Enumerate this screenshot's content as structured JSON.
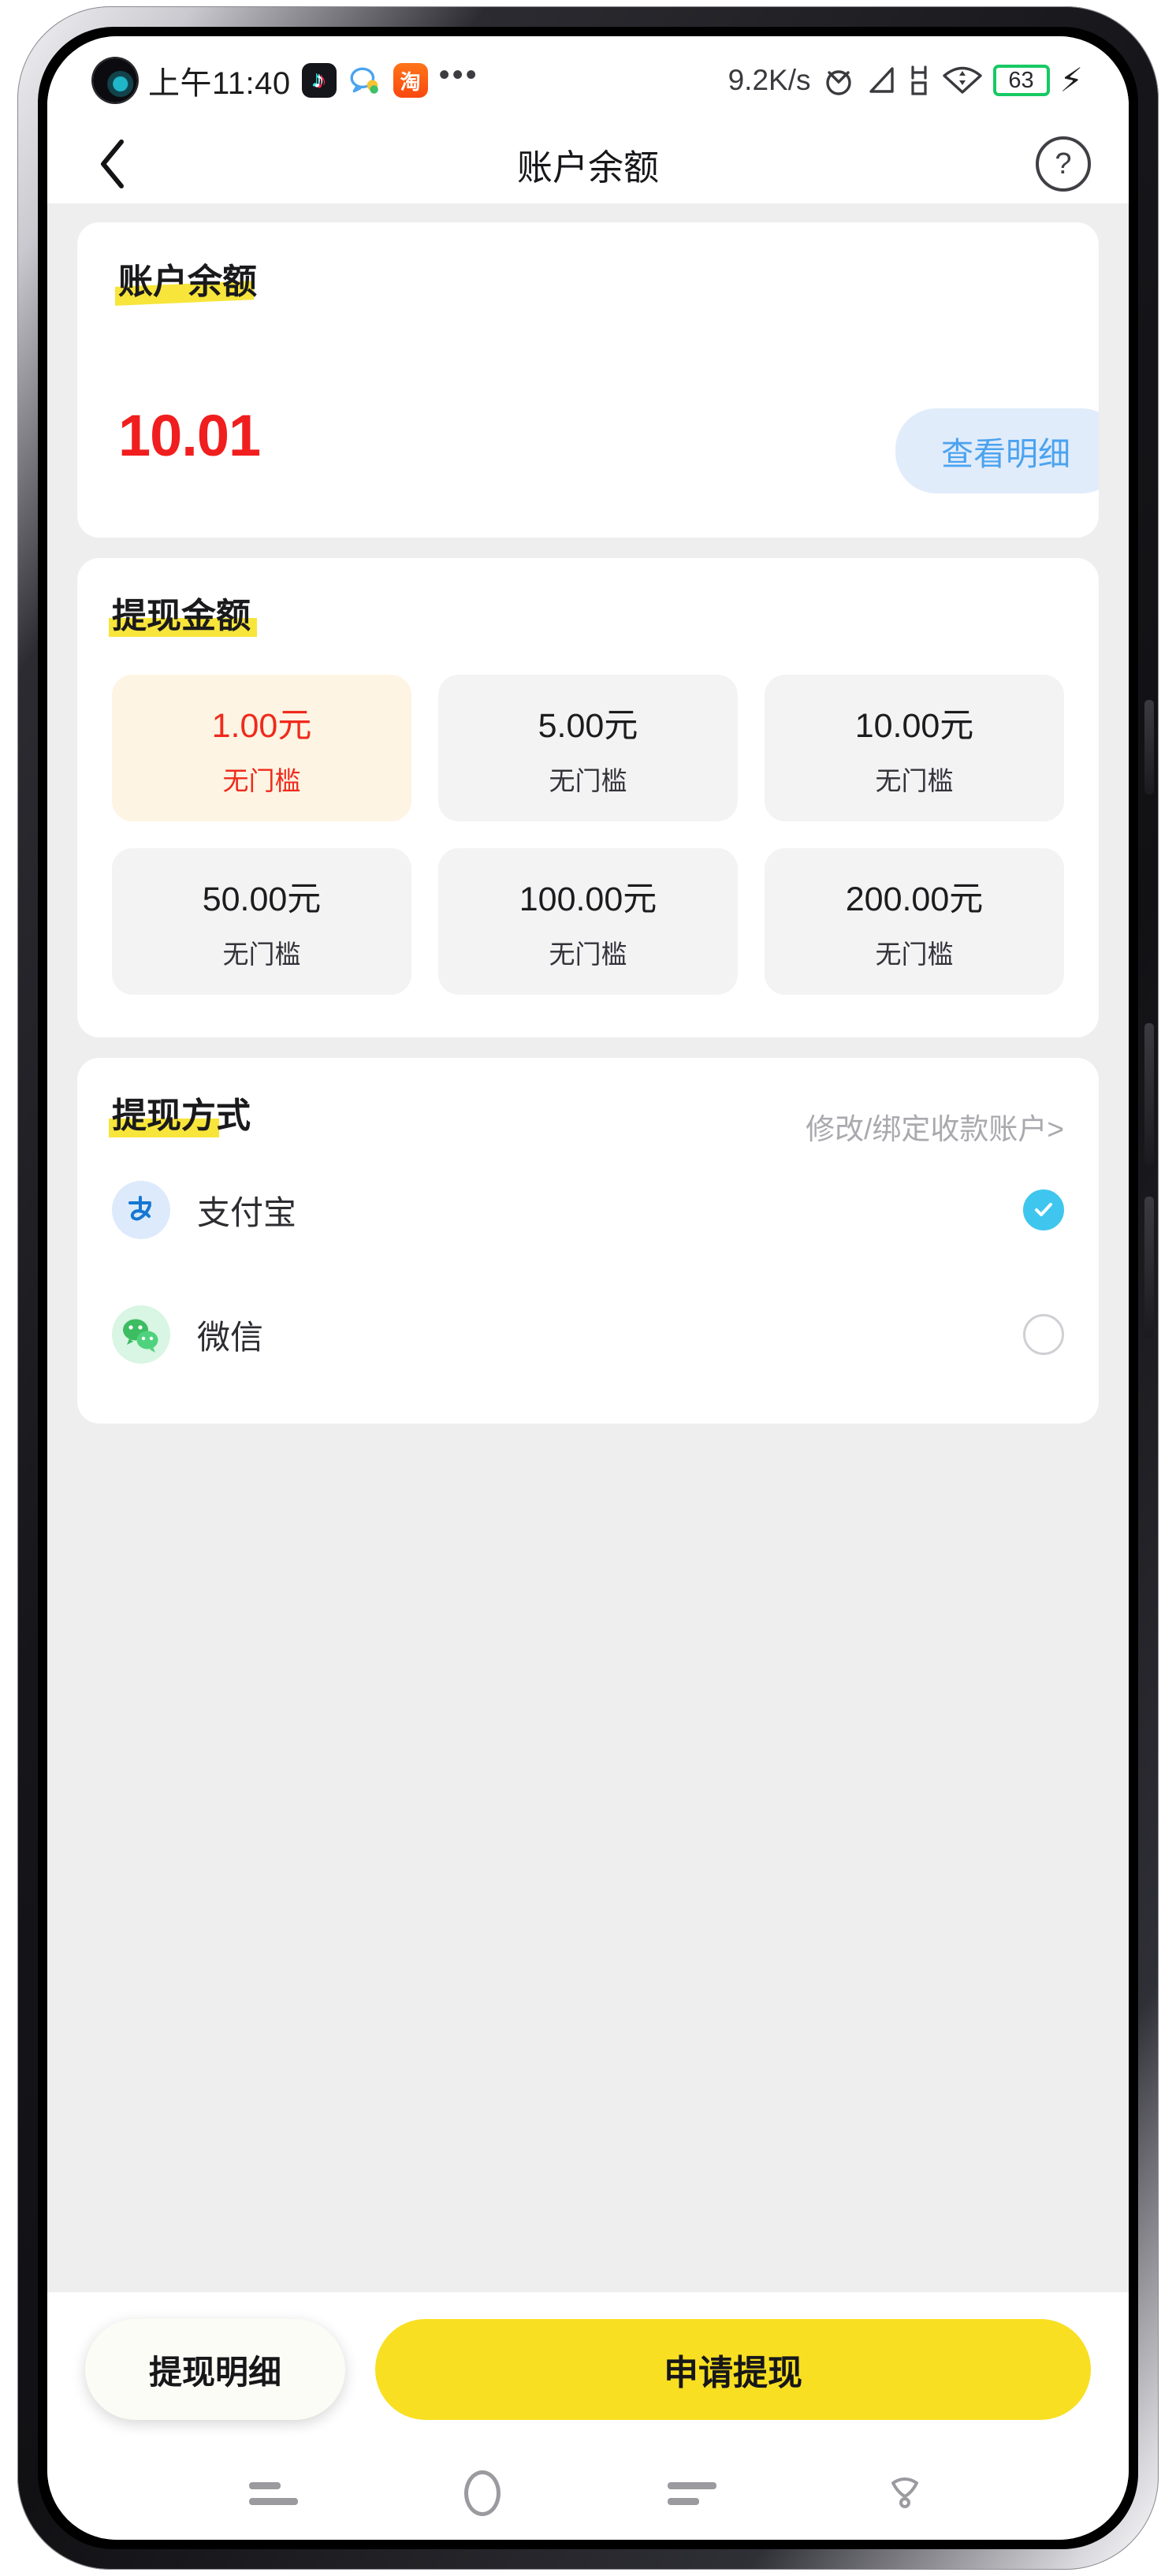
{
  "status_bar": {
    "time": "上午11:40",
    "notification_icons": [
      "tiktok-icon",
      "qq-icon",
      "taobao-icon",
      "more-dots-icon"
    ],
    "network_speed": "9.2K/s",
    "right_icons": [
      "alarm-icon",
      "signal-icon",
      "hspa-icon",
      "wifi-icon"
    ],
    "battery_level": "63",
    "charging": "⚡",
    "battery_color": "#17c964"
  },
  "nav": {
    "back_icon": "chevron-left-icon",
    "title": "账户余额",
    "help_icon": "?"
  },
  "balance_card": {
    "title": "账户余额",
    "value": "10.01",
    "value_color": "#f01e1e",
    "detail_button": "查看明细",
    "detail_button_color": "#4ba3ef"
  },
  "amount_card": {
    "title": "提现金额",
    "tiles": [
      {
        "amount": "1.00元",
        "note": "无门槛",
        "selected": true
      },
      {
        "amount": "5.00元",
        "note": "无门槛",
        "selected": false
      },
      {
        "amount": "10.00元",
        "note": "无门槛",
        "selected": false
      },
      {
        "amount": "50.00元",
        "note": "无门槛",
        "selected": false
      },
      {
        "amount": "100.00元",
        "note": "无门槛",
        "selected": false
      },
      {
        "amount": "200.00元",
        "note": "无门槛",
        "selected": false
      }
    ]
  },
  "payout_card": {
    "title": "提现方式",
    "bind_link": "修改/绑定收款账户>",
    "methods": [
      {
        "name": "支付宝",
        "icon": "alipay-icon",
        "selected": true
      },
      {
        "name": "微信",
        "icon": "wechat-icon",
        "selected": false
      }
    ],
    "selected_color": "#3fc6ee"
  },
  "action_bar": {
    "records_button": "提现明细",
    "withdraw_button": "申请提现",
    "withdraw_color": "#f9df22"
  },
  "android_nav": {
    "recents_icon": "recents-icon",
    "home_icon": "home-circle-icon",
    "back_icon": "back-icon",
    "assistant_icon": "assistant-icon"
  },
  "highlight_color": "#f7e53b"
}
